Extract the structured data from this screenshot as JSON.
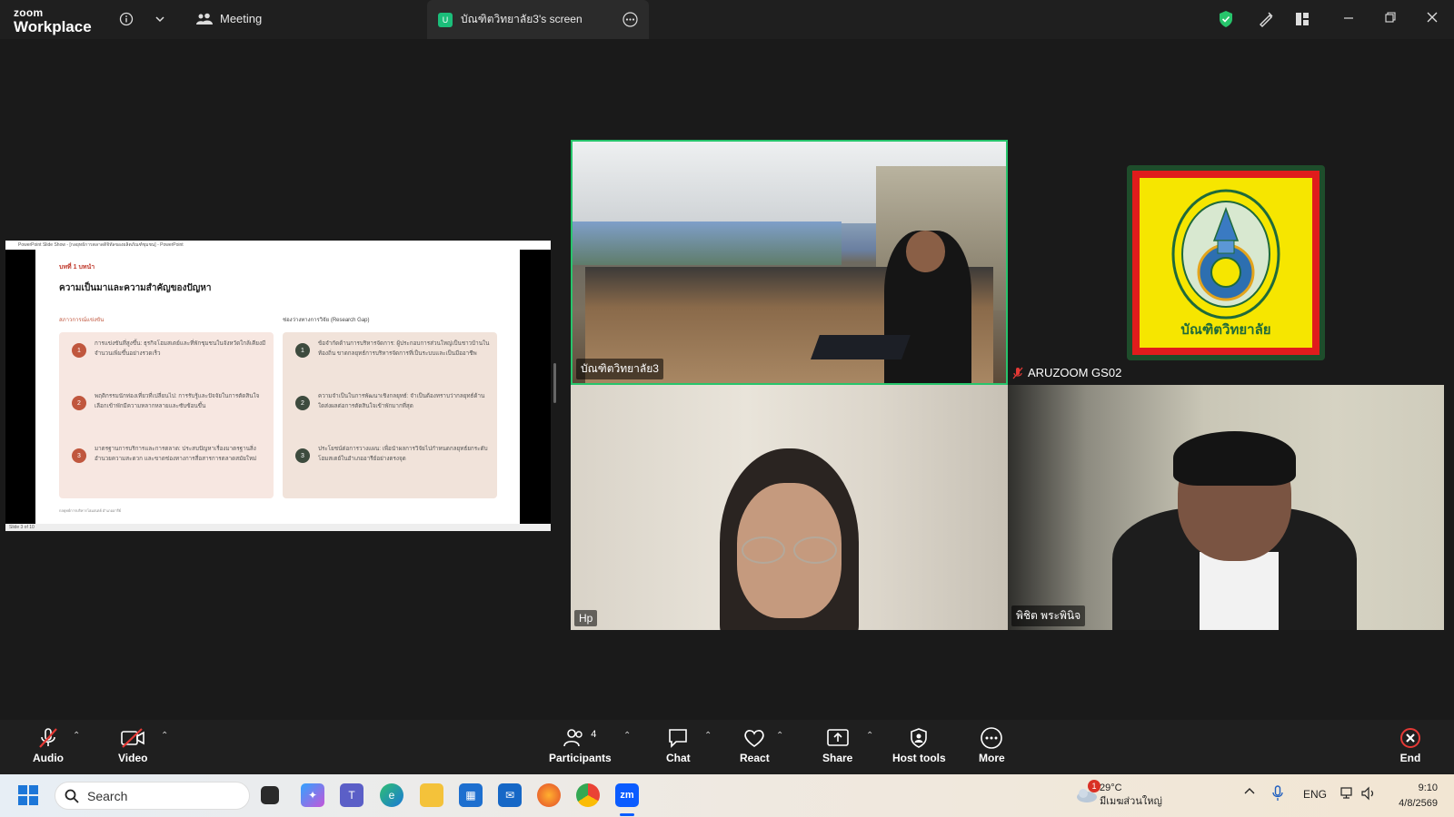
{
  "app": {
    "logo_top": "zoom",
    "logo_bottom": "Workplace"
  },
  "header": {
    "meeting_label": "Meeting",
    "share_tab_label": "บัณฑิตวิทยาลัย3's screen",
    "share_badge": "U"
  },
  "shared_screen": {
    "window_title": "PowerPoint Slide Show - [กลยุทธ์การตลาดดิจิทัลของผลิตภัณฑ์ชุมชน] - PowerPoint",
    "status": "Slide 3 of 10",
    "slide": {
      "chapter": "บทที่ 1 บทนำ",
      "title": "ความเป็นมาและความสำคัญของปัญหา",
      "left_heading": "สภาวการณ์แข่งขัน",
      "left_items": [
        {
          "num": "1",
          "text": "การแข่งขันที่สูงขึ้น: ธุรกิจโฮมสเตย์และที่พักชุมชนในจังหวัดใกล้เคียงมีจำนวนเพิ่มขึ้นอย่างรวดเร็ว"
        },
        {
          "num": "2",
          "text": "พฤติกรรมนักท่องเที่ยวที่เปลี่ยนไป: การรับรู้และปัจจัยในการตัดสินใจเลือกเข้าพักมีความหลากหลายและซับซ้อนขึ้น"
        },
        {
          "num": "3",
          "text": "มาตรฐานการบริการและการตลาด: ประสบปัญหาเรื่องมาตรฐานสิ่งอำนวยความสะดวก และขาดช่องทางการสื่อสารการตลาดสมัยใหม่"
        }
      ],
      "right_heading": "ช่องว่างทางการวิจัย (Research Gap)",
      "right_items": [
        {
          "num": "1",
          "text": "ข้อจำกัดด้านการบริหารจัดการ: ผู้ประกอบการส่วนใหญ่เป็นชาวบ้านในท้องถิ่น ขาดกลยุทธ์การบริหารจัดการที่เป็นระบบและเป็นมืออาชีพ"
        },
        {
          "num": "2",
          "text": "ความจำเป็นในการพัฒนาเชิงกลยุทธ์: จำเป็นต้องทราบว่ากลยุทธ์ด้านใดส่งผลต่อการตัดสินใจเข้าพักมากที่สุด"
        },
        {
          "num": "3",
          "text": "ประโยชน์ต่อการวางแผน: เพื่อนำผลการวิจัยไปกำหนดกลยุทธ์ยกระดับโฮมสเตย์ในอำเภออารีย์อย่างตรงจุด"
        }
      ],
      "footer": "กลยุทธ์การบริหารโฮมสเตย์ อำเภออารีย์"
    }
  },
  "participants": [
    {
      "name": "บัณฑิตวิทยาลัย3"
    },
    {
      "name": "ARUZOOM GS02"
    },
    {
      "name": "Hp"
    },
    {
      "name": "พิชิต พระพินิจ"
    }
  ],
  "logo_tile": {
    "text": "บัณฑิตวิทยาลัย"
  },
  "toolbar": {
    "audio": "Audio",
    "video": "Video",
    "participants": "Participants",
    "participants_count": "4",
    "chat": "Chat",
    "react": "React",
    "share": "Share",
    "host_tools": "Host tools",
    "more": "More",
    "end": "End"
  },
  "taskbar": {
    "search_placeholder": "Search",
    "weather_badge": "1",
    "temperature": "29°C",
    "weather_desc": "มีเมฆส่วนใหญ่",
    "lang": "ENG",
    "time": "9:10",
    "date": "4/8/2569"
  },
  "colors": {
    "active_speaker": "#27c46b",
    "end_red": "#e53935",
    "slide_num_red": "#c0573e",
    "slide_num_green": "#3d4b3e"
  }
}
